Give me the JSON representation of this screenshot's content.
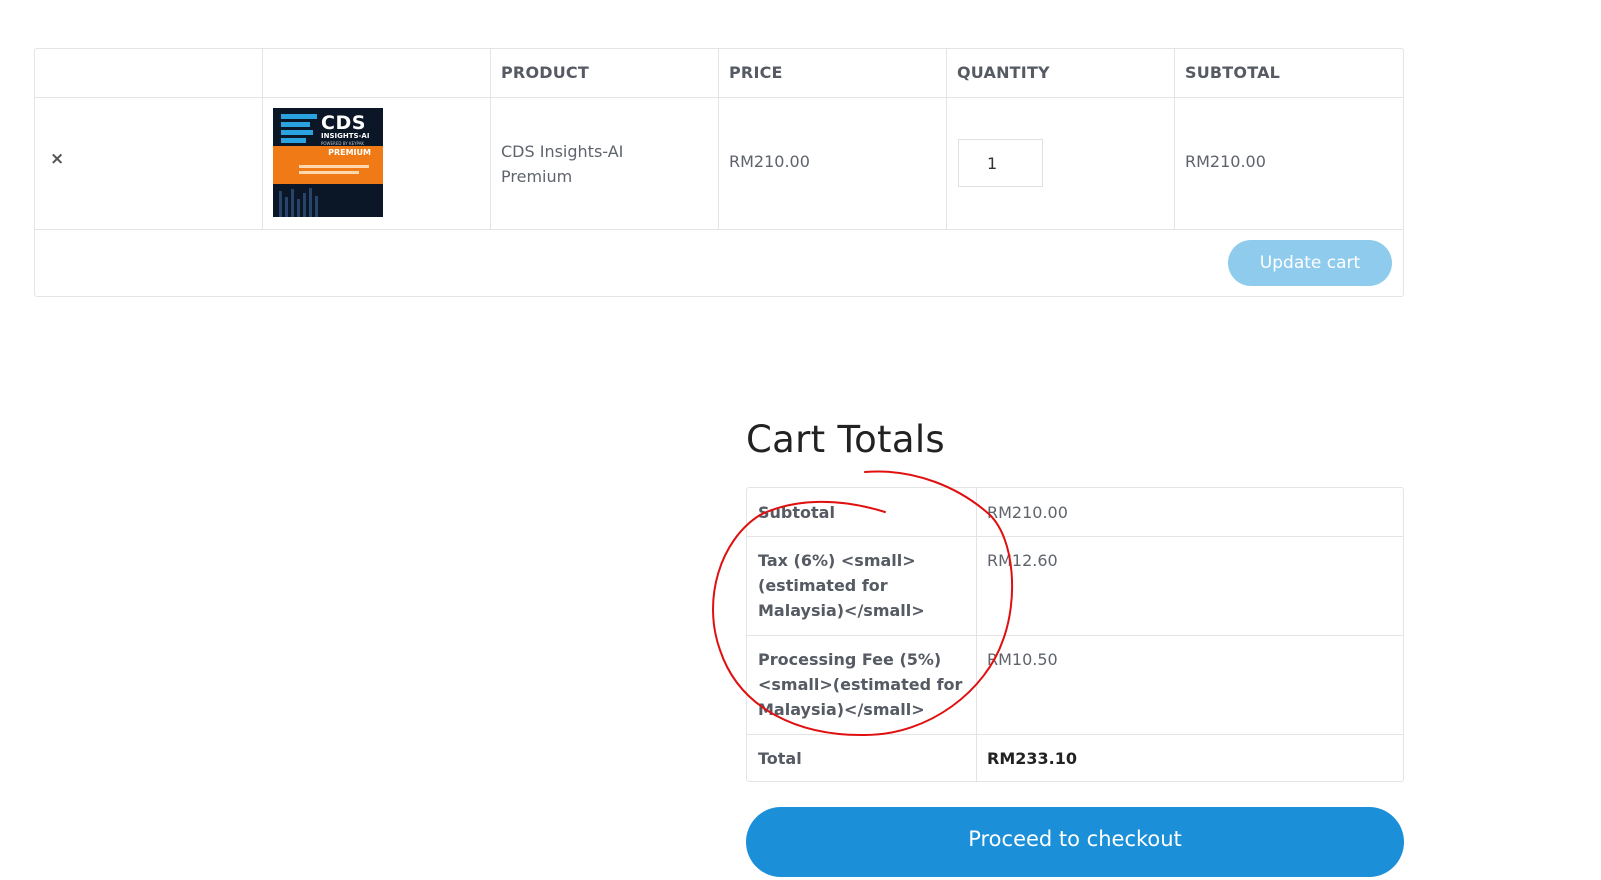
{
  "cart": {
    "columns": [
      "",
      "",
      "PRODUCT",
      "PRICE",
      "QUANTITY",
      "SUBTOTAL"
    ],
    "item": {
      "remove_icon": "×",
      "thumbnail": {
        "brand": "CDS",
        "subtitle": "INSIGHTS-AI",
        "tagline": "POWERED BY KEYPAK",
        "tier": "PREMIUM"
      },
      "product_name_line1": "CDS Insights-AI",
      "product_name_line2": "Premium",
      "price": "RM210.00",
      "quantity": "1",
      "subtotal": "RM210.00"
    },
    "update_label": "Update cart"
  },
  "totals": {
    "title": "Cart Totals",
    "rows": [
      {
        "label": "Subtotal",
        "value": "RM210.00"
      },
      {
        "label_lines": [
          "Tax (6%) <small>",
          "(estimated for",
          "Malaysia)</small>"
        ],
        "value": "RM12.60"
      },
      {
        "label_lines": [
          "Processing Fee (5%)",
          "<small>(estimated for",
          "Malaysia)</small>"
        ],
        "value": "RM10.50"
      },
      {
        "label": "Total",
        "value": "RM233.10"
      }
    ],
    "checkout_label": "Proceed to checkout"
  },
  "colors": {
    "primary": "#1b8fd8",
    "update_button": "#8fcbec",
    "annotation": "#e01010",
    "border": "#e4e4e4"
  },
  "icons": {
    "remove": "close-icon"
  }
}
